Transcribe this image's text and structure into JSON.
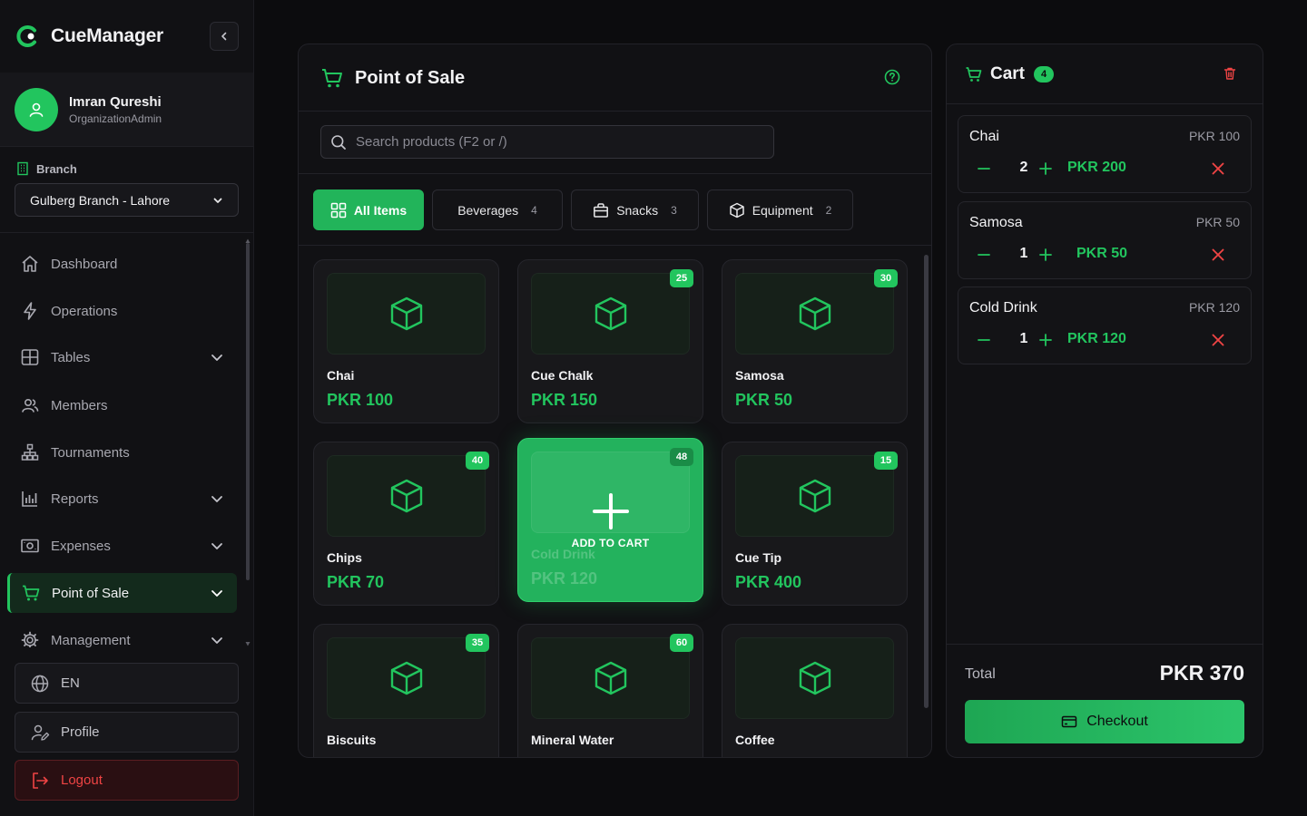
{
  "app": {
    "name": "CueManager"
  },
  "user": {
    "name": "Imran Qureshi",
    "role": "OrganizationAdmin"
  },
  "branch": {
    "label": "Branch",
    "selected": "Gulberg Branch - Lahore"
  },
  "nav": [
    {
      "label": "Dashboard",
      "icon": "home-icon"
    },
    {
      "label": "Operations",
      "icon": "bolt-icon"
    },
    {
      "label": "Tables",
      "icon": "grid-icon",
      "expandable": true
    },
    {
      "label": "Members",
      "icon": "users-icon"
    },
    {
      "label": "Tournaments",
      "icon": "bracket-icon"
    },
    {
      "label": "Reports",
      "icon": "chart-icon",
      "expandable": true
    },
    {
      "label": "Expenses",
      "icon": "cash-icon",
      "expandable": true
    },
    {
      "label": "Point of Sale",
      "icon": "cart-icon",
      "expandable": true,
      "active": true
    },
    {
      "label": "Management",
      "icon": "gear-icon",
      "expandable": true
    }
  ],
  "sidebar_bottom": {
    "language": "EN",
    "profile": "Profile",
    "logout": "Logout"
  },
  "pos": {
    "title": "Point of Sale",
    "search_placeholder": "Search products (F2 or /)",
    "tabs": [
      {
        "label": "All Items",
        "count": "",
        "active": true
      },
      {
        "label": "Beverages",
        "count": "4"
      },
      {
        "label": "Snacks",
        "count": "3"
      },
      {
        "label": "Equipment",
        "count": "2"
      }
    ],
    "products": [
      {
        "name": "Chai",
        "price": "PKR 100",
        "stock": ""
      },
      {
        "name": "Cue Chalk",
        "price": "PKR 150",
        "stock": "25"
      },
      {
        "name": "Samosa",
        "price": "PKR 50",
        "stock": "30"
      },
      {
        "name": "Chips",
        "price": "PKR 70",
        "stock": "40"
      },
      {
        "name": "Cold Drink",
        "price": "PKR 120",
        "stock": "48",
        "hovered": true
      },
      {
        "name": "Cue Tip",
        "price": "PKR 400",
        "stock": "15"
      },
      {
        "name": "Biscuits",
        "price": "",
        "stock": "35"
      },
      {
        "name": "Mineral Water",
        "price": "",
        "stock": "60"
      },
      {
        "name": "Coffee",
        "price": "",
        "stock": ""
      }
    ],
    "hover_action": "ADD TO CART"
  },
  "cart": {
    "title": "Cart",
    "count": "4",
    "items": [
      {
        "name": "Chai",
        "unit_price": "PKR 100",
        "qty": "2",
        "line_total": "PKR 200"
      },
      {
        "name": "Samosa",
        "unit_price": "PKR 50",
        "qty": "1",
        "line_total": "PKR 50"
      },
      {
        "name": "Cold Drink",
        "unit_price": "PKR 120",
        "qty": "1",
        "line_total": "PKR 120"
      }
    ],
    "total_label": "Total",
    "total_value": "PKR 370",
    "checkout_label": "Checkout"
  },
  "colors": {
    "accent": "#22c55e",
    "danger": "#ef4444",
    "background": "#0c0c0e",
    "panel": "#111114"
  }
}
